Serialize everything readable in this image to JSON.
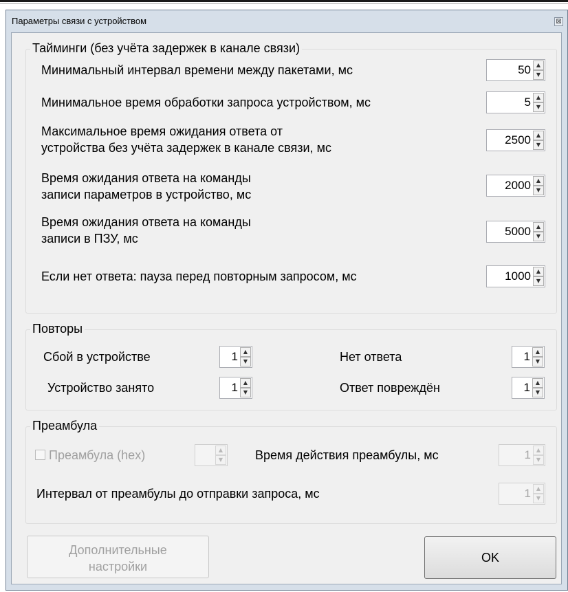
{
  "window": {
    "title": "Параметры связи с устройством",
    "close_glyph": "⊠"
  },
  "timings": {
    "title": "Тайминги (без учёта задержек в канале связи)",
    "rows": [
      {
        "label": "Минимальный интервал времени между пакетами, мс",
        "value": "50"
      },
      {
        "label": "Минимальное время обработки запроса устройством, мс",
        "value": "5"
      },
      {
        "label_line1": "Максимальное время ожидания ответа от",
        "label_line2": "устройства без учёта задержек в канале связи, мс",
        "value": "2500"
      },
      {
        "label_line1": "Время ожидания ответа на команды",
        "label_line2": " записи параметров в устройство, мс",
        "value": "2000"
      },
      {
        "label_line1": "Время ожидания ответа на команды",
        "label_line2": " записи в ПЗУ, мс",
        "value": "5000"
      },
      {
        "label": "Если нет ответа: пауза перед повторным запросом, мс",
        "value": "1000"
      }
    ]
  },
  "retries": {
    "title": "Повторы",
    "device_failure": {
      "label": "Сбой в устройстве",
      "value": "1"
    },
    "device_busy": {
      "label": "Устройство занято",
      "value": "1"
    },
    "no_response": {
      "label": "Нет ответа",
      "value": "1"
    },
    "response_corrupted": {
      "label": "Ответ повреждён",
      "value": "1"
    }
  },
  "preamble": {
    "title": "Преамбула",
    "checkbox_label": "Преамбула (hex)",
    "checkbox_checked": false,
    "hex_value": "",
    "duration_label": "Время действия преамбулы, мс",
    "duration_value": "1",
    "interval_label": "Интервал от преамбулы до отправки запроса, мс",
    "interval_value": "1"
  },
  "buttons": {
    "advanced_line1": "Дополнительные",
    "advanced_line2": "настройки",
    "ok": "OK"
  },
  "icons": {
    "spin_up": "▲",
    "spin_down": "▼"
  },
  "colors": {
    "frame": "#d6dfe9",
    "client": "#f0f0f0",
    "disabled_text": "#a0a0a0"
  }
}
